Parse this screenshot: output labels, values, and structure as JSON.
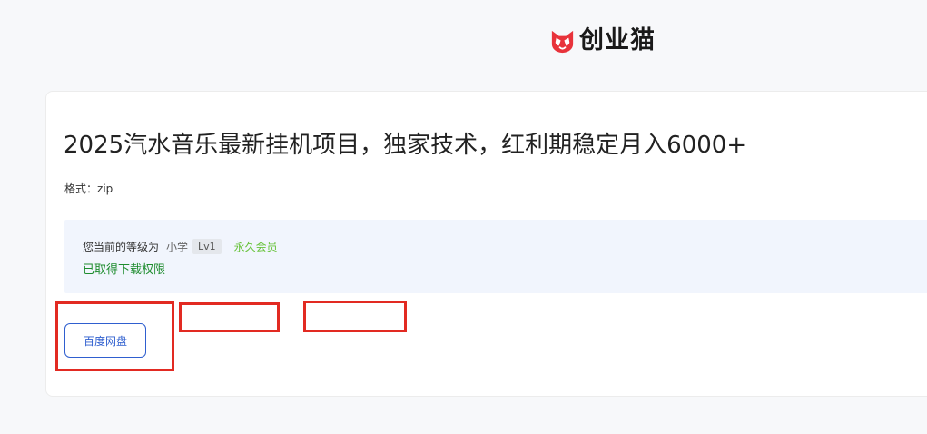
{
  "header": {
    "logo_text": "创业猫",
    "logo_icon": "cat-face-icon",
    "brand_color": "#e8333b"
  },
  "resource": {
    "title": "2025汽水音乐最新挂机项目，独家技术，红利期稳定月入6000+",
    "format_label": "格式：",
    "format_value": "zip"
  },
  "permission": {
    "level_prefix": "您当前的等级为",
    "level_name": "小学",
    "level_badge": "Lv1",
    "membership": "永久会员",
    "status": "已取得下载权限",
    "status_color": "#1e8c2e",
    "membership_color": "#67c23a"
  },
  "downloads": {
    "baidu_label": "百度网盘"
  },
  "annotations": {
    "highlight_color": "#e22a22"
  }
}
